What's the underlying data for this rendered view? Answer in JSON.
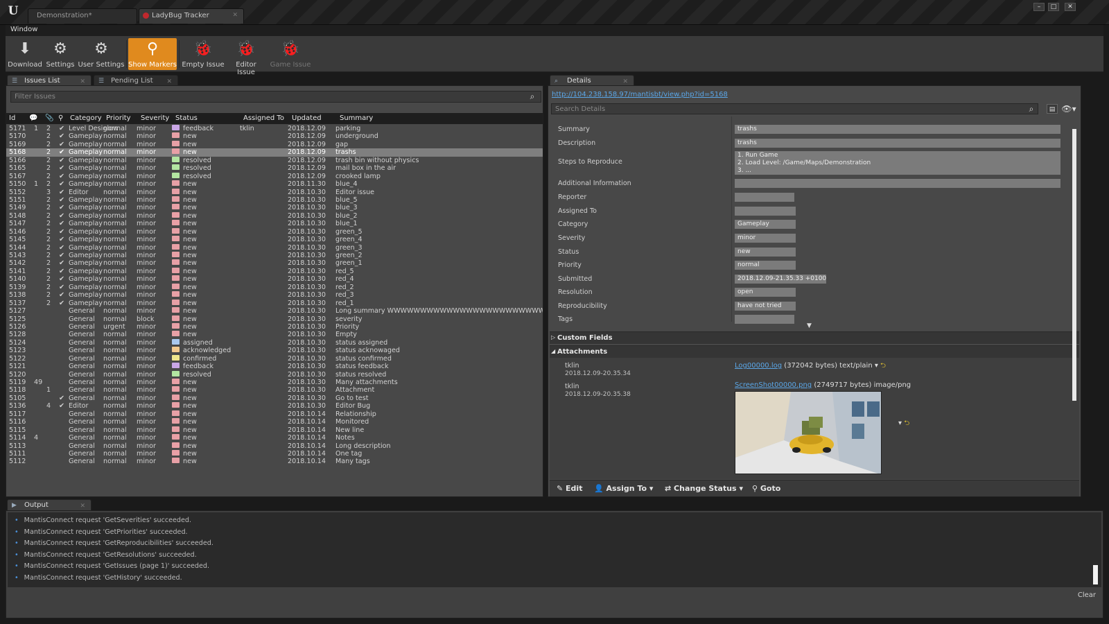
{
  "window": {
    "tabs": [
      {
        "label": "Demonstration*",
        "active": false
      },
      {
        "label": "LadyBug Tracker",
        "active": true
      }
    ],
    "controls": [
      "minimize-icon",
      "maximize-icon",
      "close-icon"
    ]
  },
  "menu": {
    "items": [
      "Window"
    ]
  },
  "toolbar": {
    "buttons": [
      {
        "label": "Download",
        "icon": "download-icon"
      },
      {
        "label": "Settings",
        "icon": "settings-icon"
      },
      {
        "label": "User Settings",
        "icon": "user-settings-icon"
      },
      {
        "label": "Show Markers",
        "icon": "marker-icon",
        "active": true
      },
      {
        "label": "Empty Issue",
        "icon": "ladybug-add-icon"
      },
      {
        "label": "Editor Issue",
        "icon": "ladybug-editor-icon"
      },
      {
        "label": "Game Issue",
        "icon": "ladybug-game-icon",
        "disabled": true
      }
    ]
  },
  "issues_panel": {
    "tabs": [
      "Issues List",
      "Pending List"
    ],
    "filter_placeholder": "Filter Issues",
    "columns": {
      "id": "Id",
      "category": "Category",
      "priority": "Priority",
      "severity": "Severity",
      "status": "Status",
      "assigned": "Assigned To",
      "updated": "Updated",
      "summary": "Summary"
    },
    "column_icons": [
      "comments-icon",
      "attachment-icon",
      "marker-icon"
    ],
    "rows": [
      [
        "5171",
        "1",
        "2",
        true,
        "Level Desiglow",
        "normal",
        "minor",
        "feedback",
        "tklin",
        "2018.12.09",
        "parking"
      ],
      [
        "5170",
        "",
        "2",
        true,
        "Gameplay",
        "normal",
        "minor",
        "new",
        "",
        "2018.12.09",
        "underground"
      ],
      [
        "5169",
        "",
        "2",
        true,
        "Gameplay",
        "normal",
        "minor",
        "new",
        "",
        "2018.12.09",
        "gap"
      ],
      [
        "5168",
        "",
        "2",
        true,
        "Gameplay",
        "normal",
        "minor",
        "new",
        "",
        "2018.12.09",
        "trashs"
      ],
      [
        "5166",
        "",
        "2",
        true,
        "Gameplay",
        "normal",
        "minor",
        "resolved",
        "",
        "2018.12.09",
        "trash bin without physics"
      ],
      [
        "5165",
        "",
        "2",
        true,
        "Gameplay",
        "normal",
        "minor",
        "resolved",
        "",
        "2018.12.09",
        "mail box in the air"
      ],
      [
        "5167",
        "",
        "2",
        true,
        "Gameplay",
        "normal",
        "minor",
        "resolved",
        "",
        "2018.12.09",
        "crooked lamp"
      ],
      [
        "5150",
        "1",
        "2",
        true,
        "Gameplay",
        "normal",
        "minor",
        "new",
        "",
        "2018.11.30",
        "blue_4"
      ],
      [
        "5152",
        "",
        "3",
        true,
        "Editor",
        "normal",
        "minor",
        "new",
        "",
        "2018.10.30",
        "Editor issue"
      ],
      [
        "5151",
        "",
        "2",
        true,
        "Gameplay",
        "normal",
        "minor",
        "new",
        "",
        "2018.10.30",
        "blue_5"
      ],
      [
        "5149",
        "",
        "2",
        true,
        "Gameplay",
        "normal",
        "minor",
        "new",
        "",
        "2018.10.30",
        "blue_3"
      ],
      [
        "5148",
        "",
        "2",
        true,
        "Gameplay",
        "normal",
        "minor",
        "new",
        "",
        "2018.10.30",
        "blue_2"
      ],
      [
        "5147",
        "",
        "2",
        true,
        "Gameplay",
        "normal",
        "minor",
        "new",
        "",
        "2018.10.30",
        "blue_1"
      ],
      [
        "5146",
        "",
        "2",
        true,
        "Gameplay",
        "normal",
        "minor",
        "new",
        "",
        "2018.10.30",
        "green_5"
      ],
      [
        "5145",
        "",
        "2",
        true,
        "Gameplay",
        "normal",
        "minor",
        "new",
        "",
        "2018.10.30",
        "green_4"
      ],
      [
        "5144",
        "",
        "2",
        true,
        "Gameplay",
        "normal",
        "minor",
        "new",
        "",
        "2018.10.30",
        "green_3"
      ],
      [
        "5143",
        "",
        "2",
        true,
        "Gameplay",
        "normal",
        "minor",
        "new",
        "",
        "2018.10.30",
        "green_2"
      ],
      [
        "5142",
        "",
        "2",
        true,
        "Gameplay",
        "normal",
        "minor",
        "new",
        "",
        "2018.10.30",
        "green_1"
      ],
      [
        "5141",
        "",
        "2",
        true,
        "Gameplay",
        "normal",
        "minor",
        "new",
        "",
        "2018.10.30",
        "red_5"
      ],
      [
        "5140",
        "",
        "2",
        true,
        "Gameplay",
        "normal",
        "minor",
        "new",
        "",
        "2018.10.30",
        "red_4"
      ],
      [
        "5139",
        "",
        "2",
        true,
        "Gameplay",
        "normal",
        "minor",
        "new",
        "",
        "2018.10.30",
        "red_2"
      ],
      [
        "5138",
        "",
        "2",
        true,
        "Gameplay",
        "normal",
        "minor",
        "new",
        "",
        "2018.10.30",
        "red_3"
      ],
      [
        "5137",
        "",
        "2",
        true,
        "Gameplay",
        "normal",
        "minor",
        "new",
        "",
        "2018.10.30",
        "red_1"
      ],
      [
        "5127",
        "",
        "",
        false,
        "General",
        "normal",
        "minor",
        "new",
        "",
        "2018.10.30",
        "Long summary WWWWWWWWWWWWWWWWWWWWWWWWWWWWWW"
      ],
      [
        "5125",
        "",
        "",
        false,
        "General",
        "normal",
        "block",
        "new",
        "",
        "2018.10.30",
        "severity"
      ],
      [
        "5126",
        "",
        "",
        false,
        "General",
        "urgent",
        "minor",
        "new",
        "",
        "2018.10.30",
        "Priority"
      ],
      [
        "5128",
        "",
        "",
        false,
        "General",
        "normal",
        "minor",
        "new",
        "",
        "2018.10.30",
        "Empty"
      ],
      [
        "5124",
        "",
        "",
        false,
        "General",
        "normal",
        "minor",
        "assigned",
        "",
        "2018.10.30",
        "status assigned"
      ],
      [
        "5123",
        "",
        "",
        false,
        "General",
        "normal",
        "minor",
        "acknowledged",
        "",
        "2018.10.30",
        "status acknowaged"
      ],
      [
        "5122",
        "",
        "",
        false,
        "General",
        "normal",
        "minor",
        "confirmed",
        "",
        "2018.10.30",
        "status confirmed"
      ],
      [
        "5121",
        "",
        "",
        false,
        "General",
        "normal",
        "minor",
        "feedback",
        "",
        "2018.10.30",
        "status feedback"
      ],
      [
        "5120",
        "",
        "",
        false,
        "General",
        "normal",
        "minor",
        "resolved",
        "",
        "2018.10.30",
        "status resolved"
      ],
      [
        "5119",
        "49",
        "",
        false,
        "General",
        "normal",
        "minor",
        "new",
        "",
        "2018.10.30",
        "Many attachments"
      ],
      [
        "5118",
        "",
        "1",
        false,
        "General",
        "normal",
        "minor",
        "new",
        "",
        "2018.10.30",
        "Attachment"
      ],
      [
        "5105",
        "",
        "",
        true,
        "General",
        "normal",
        "minor",
        "new",
        "",
        "2018.10.30",
        "Go to test"
      ],
      [
        "5136",
        "",
        "4",
        true,
        "Editor",
        "normal",
        "minor",
        "new",
        "",
        "2018.10.30",
        "Editor Bug"
      ],
      [
        "5117",
        "",
        "",
        false,
        "General",
        "normal",
        "minor",
        "new",
        "",
        "2018.10.14",
        "Relationship"
      ],
      [
        "5116",
        "",
        "",
        false,
        "General",
        "normal",
        "minor",
        "new",
        "",
        "2018.10.14",
        "Monitored"
      ],
      [
        "5115",
        "",
        "",
        false,
        "General",
        "normal",
        "minor",
        "new",
        "",
        "2018.10.14",
        "New line"
      ],
      [
        "5114",
        "4",
        "",
        false,
        "General",
        "normal",
        "minor",
        "new",
        "",
        "2018.10.14",
        "Notes"
      ],
      [
        "5113",
        "",
        "",
        false,
        "General",
        "normal",
        "minor",
        "new",
        "",
        "2018.10.14",
        "Long description"
      ],
      [
        "5111",
        "",
        "",
        false,
        "General",
        "normal",
        "minor",
        "new",
        "",
        "2018.10.14",
        "One tag"
      ],
      [
        "5112",
        "",
        "",
        false,
        "General",
        "normal",
        "minor",
        "new",
        "",
        "2018.10.14",
        "Many tags"
      ]
    ],
    "selected_id": "5168",
    "status_colors": {
      "new": "#e8a0a6",
      "feedback": "#c9a6e6",
      "resolved": "#b3e6a1",
      "assigned": "#a9c8ee",
      "acknowledged": "#f2c98e",
      "confirmed": "#f0e68c"
    }
  },
  "details_panel": {
    "tab": "Details",
    "link": "http://104.238.158.97/mantisbt/view.php?id=5168",
    "search_placeholder": "Search Details",
    "fields": [
      {
        "label": "Summary",
        "value": "trashs"
      },
      {
        "label": "Description",
        "value": "trashs"
      },
      {
        "label": "Steps to Reproduce",
        "lines": [
          "1. Run Game",
          "2. Load Level: /Game/Maps/Demonstration",
          "3. ..."
        ]
      },
      {
        "label": "Additional Information",
        "value": ""
      },
      {
        "label": "Reporter",
        "value": ""
      },
      {
        "label": "Assigned To",
        "value": ""
      },
      {
        "label": "Category",
        "value": "Gameplay"
      },
      {
        "label": "Severity",
        "value": "minor"
      },
      {
        "label": "Status",
        "value": "new"
      },
      {
        "label": "Priority",
        "value": "normal"
      },
      {
        "label": "Submitted",
        "value": "2018.12.09-21.35.33 +0100"
      },
      {
        "label": "Resolution",
        "value": "open"
      },
      {
        "label": "Reproducibility",
        "value": "have not tried"
      },
      {
        "label": "Tags",
        "value": ""
      }
    ],
    "custom_fields_label": "Custom Fields",
    "attachments_label": "Attachments",
    "attachments": [
      {
        "user": "tklin",
        "date": "2018.12.09-20.35.34",
        "file": "Log00000.log",
        "info": "(372042 bytes) text/plain"
      },
      {
        "user": "tklin",
        "date": "2018.12.09-20.35.38",
        "file": "ScreenShot00000.png",
        "info": "(2749717 bytes) image/png"
      }
    ],
    "actions": [
      {
        "label": "Edit",
        "icon": "pencil-icon"
      },
      {
        "label": "Assign To",
        "icon": "assign-user-icon"
      },
      {
        "label": "Change Status",
        "icon": "swap-icon"
      },
      {
        "label": "Goto",
        "icon": "marker-icon"
      }
    ]
  },
  "output_panel": {
    "tab": "Output",
    "lines": [
      "MantisConnect request 'GetSeverities' succeeded.",
      "MantisConnect request 'GetPriorities' succeeded.",
      "MantisConnect request 'GetReproducibilities' succeeded.",
      "MantisConnect request 'GetResolutions' succeeded.",
      "MantisConnect request 'GetIssues (page 1)' succeeded.",
      "MantisConnect request 'GetHistory' succeeded."
    ],
    "clear_label": "Clear"
  }
}
